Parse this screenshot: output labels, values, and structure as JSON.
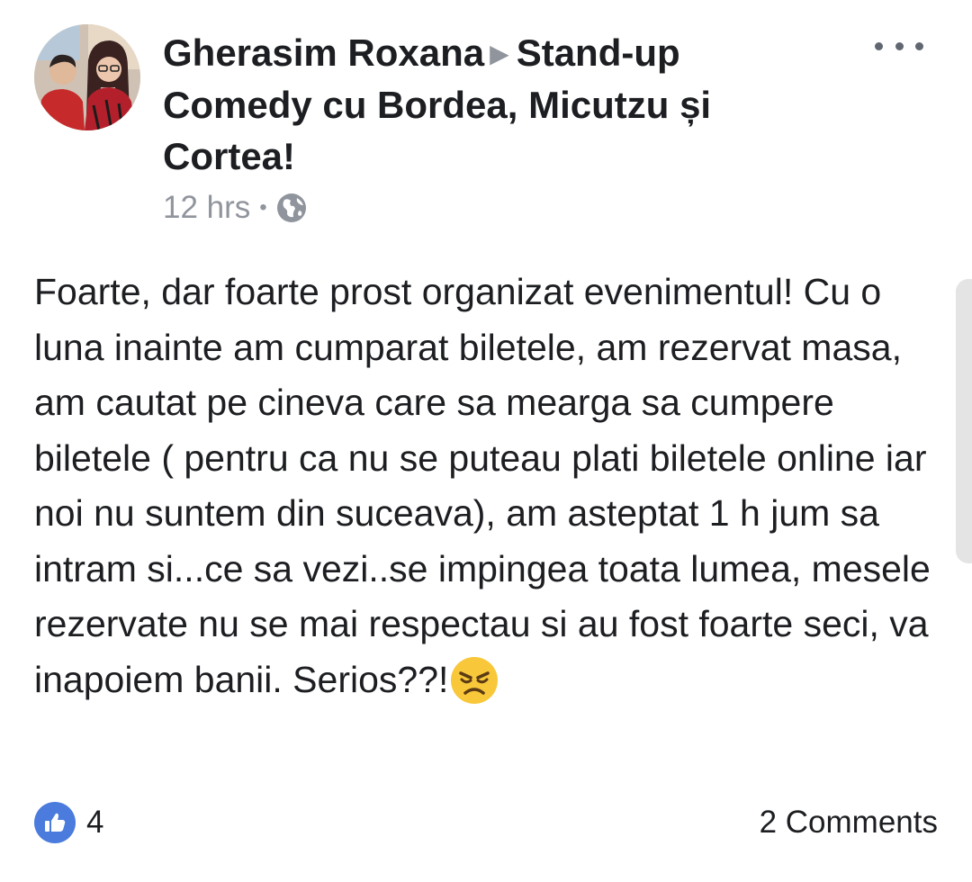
{
  "post": {
    "author": "Gherasim Roxana",
    "event": "Stand-up Comedy cu Bordea, Micutzu și Cortea!",
    "time": "12 hrs",
    "separator": "•",
    "privacy_icon": "globe-icon",
    "body_text": "Foarte, dar foarte prost organizat evenimentul! Cu o luna inainte am cumparat biletele, am rezervat masa, am cautat pe cineva care sa mearga sa cumpere biletele ( pentru ca nu se puteau plati biletele online iar noi nu suntem din suceava), am asteptat 1 h jum sa intram si...ce sa vezi..se impingea toata lumea, mesele rezervate nu se mai respectau si au fost foarte seci, va inapoiem banii. Serios??!",
    "emoji": "angry-face-emoji"
  },
  "footer": {
    "like_count": "4",
    "comments_label": "2 Comments"
  },
  "colors": {
    "like_blue": "#4a7bdd",
    "meta_gray": "#90949c",
    "text": "#1c1e21"
  }
}
